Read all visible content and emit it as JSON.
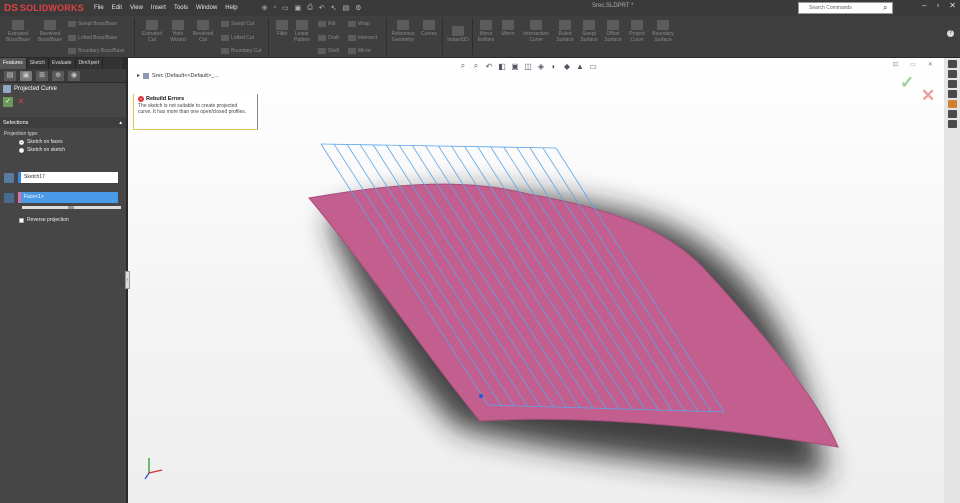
{
  "app": {
    "logo_mark": "DS",
    "logo_text": "SOLIDWORKS",
    "doc_title": "Srec.SLDPRT *"
  },
  "menus": [
    "File",
    "Edit",
    "View",
    "Insert",
    "Tools",
    "Window",
    "Help"
  ],
  "search": {
    "placeholder": "Search Commands"
  },
  "ribbon": {
    "extruded_boss": "Extruded Boss/Base",
    "revolved_boss": "Revolved Boss/Base",
    "swept_boss": "Swept Boss/Base",
    "lofted_boss": "Lofted Boss/Base",
    "boundary_boss": "Boundary Boss/Base",
    "extruded_cut": "Extruded Cut",
    "hole_wizard": "Hole Wizard",
    "revolved_cut": "Revolved Cut",
    "swept_cut": "Swept Cut",
    "lofted_cut": "Lofted Cut",
    "boundary_cut": "Boundary Cut",
    "fillet": "Fillet",
    "linear_pattern": "Linear Pattern",
    "rib": "Rib",
    "draft": "Draft",
    "shell": "Shell",
    "wrap": "Wrap",
    "intersect": "Intersect",
    "mirror": "Mirror",
    "reference_geometry": "Reference Geometry",
    "curves": "Curves",
    "instant3d": "Instant3D",
    "mirror_entities": "Mirror Entities",
    "mirror2": "Mirror",
    "intersection_curve": "Intersection Curve",
    "ruled_surface": "Ruled Surface",
    "swept_surface": "Swept Surface",
    "offset_surface": "Offset Surface",
    "project_curve": "Project Curve",
    "boundary_surface": "Boundary Surface"
  },
  "tabs": [
    {
      "label": "Features",
      "active": true
    },
    {
      "label": "Sketch",
      "active": false
    },
    {
      "label": "Evaluate",
      "active": false
    },
    {
      "label": "DimXpert",
      "active": false
    }
  ],
  "property_manager": {
    "title": "Projected Curve",
    "help_glyph": "?",
    "ok_glyph": "✓",
    "cancel_glyph": "✕",
    "selections_label": "Selections",
    "collapse_glyph": "▴",
    "projection_type_label": "Projection type:",
    "option_sketch_on_faces": "Sketch on faces",
    "option_sketch_on_sketch": "Sketch on sketch",
    "sketch_field_value": "Sketch17",
    "face_field_value": "Face<1>",
    "reverse_projection_label": "Reverse projection"
  },
  "tree": {
    "expand_glyph": "▸",
    "item": "Srec (Default<<Default>_..."
  },
  "error": {
    "title": "Rebuild Errors",
    "message": "The sketch is not suitable to create projected curve. It has more than one open/closed profiles."
  },
  "viewport": {
    "confirm_ok": "✓",
    "confirm_cancel": "✕",
    "surface_color": "#c25f8f",
    "sketch_line_color": "#5aa6e8",
    "view_ctrls": [
      "⊡",
      "▭",
      "✕"
    ],
    "heads_up_icons": [
      "zoom-to-fit-icon",
      "zoom-area-icon",
      "previous-view-icon",
      "section-view-icon",
      "view-orientation-icon",
      "display-style-icon",
      "hide-show-icon",
      "appearance-icon",
      "scene-icon",
      "view-settings-icon"
    ]
  }
}
